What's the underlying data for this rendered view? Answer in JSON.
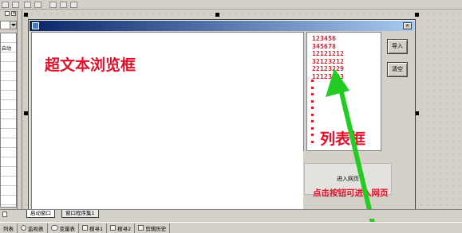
{
  "form": {
    "close_glyph": "×",
    "browser_label": "超文本浏览框",
    "list_items": [
      "123456",
      "345678",
      "12121212",
      "32123212",
      "22123229",
      "12123223"
    ],
    "list_dots": 10,
    "list_label": "列表框",
    "import_button": "导入",
    "clear_button": "清空",
    "enter_button": "进入网页",
    "enter_hint": "点击按钮可进入网页"
  },
  "left_panel": {
    "close_glyph": "×",
    "cell_text": "启动"
  },
  "tabs": [
    {
      "label": "启动窗口"
    },
    {
      "label": "窗口程序集1"
    }
  ],
  "status_bar": {
    "items": [
      {
        "label": "列表",
        "icon": "list-icon"
      },
      {
        "label": "监视表",
        "icon": "search-icon"
      },
      {
        "label": "变量表",
        "icon": "glasses-icon"
      },
      {
        "label": "搜寻1",
        "icon": "find-icon"
      },
      {
        "label": "搜寻2",
        "icon": "find-icon"
      },
      {
        "label": "剪辑历史",
        "icon": "clipboard-icon"
      }
    ]
  },
  "colors": {
    "annotation": "#e0102a",
    "arrow": "#22cc22",
    "titlebar": "#0a246a"
  }
}
